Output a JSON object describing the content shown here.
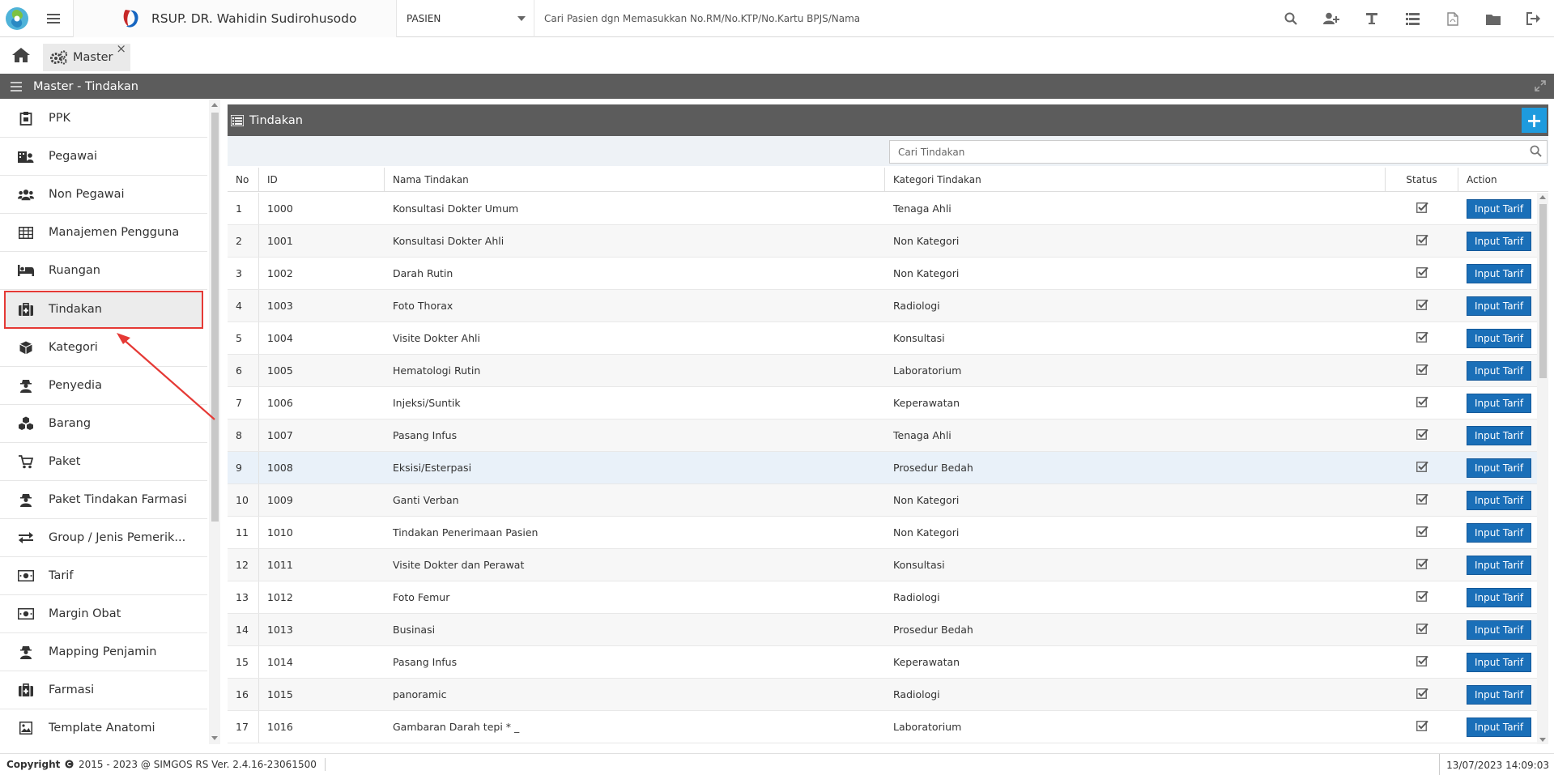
{
  "header": {
    "hospital_name": "RSUP. DR. Wahidin Sudirohusodo",
    "selector_value": "PASIEN",
    "search_placeholder": "Cari Pasien dgn Memasukkan No.RM/No.KTP/No.Kartu BPJS/Nama",
    "toolbar_icons": [
      "search-icon",
      "add-user-icon",
      "text-icon",
      "list-icon",
      "pdf-file-icon",
      "folder-icon",
      "logout-icon"
    ]
  },
  "tabs": [
    {
      "label": "Master",
      "icon": "gears-icon"
    }
  ],
  "title_bar": {
    "title": "Master - Tindakan"
  },
  "sidebar": {
    "items": [
      {
        "label": "PPK",
        "icon": "clipboard-icon"
      },
      {
        "label": "Pegawai",
        "icon": "building-user-icon"
      },
      {
        "label": "Non Pegawai",
        "icon": "users-icon"
      },
      {
        "label": "Manajemen Pengguna",
        "icon": "table-icon"
      },
      {
        "label": "Ruangan",
        "icon": "bed-icon"
      },
      {
        "label": "Tindakan",
        "icon": "medkit-icon",
        "active": true
      },
      {
        "label": "Kategori",
        "icon": "cube-icon"
      },
      {
        "label": "Penyedia",
        "icon": "user-secret-icon"
      },
      {
        "label": "Barang",
        "icon": "cubes-icon"
      },
      {
        "label": "Paket",
        "icon": "cart-icon"
      },
      {
        "label": "Paket Tindakan Farmasi",
        "icon": "user-secret-icon"
      },
      {
        "label": "Group / Jenis Pemerik...",
        "icon": "exchange-icon"
      },
      {
        "label": "Tarif",
        "icon": "money-icon"
      },
      {
        "label": "Margin Obat",
        "icon": "money-icon"
      },
      {
        "label": "Mapping Penjamin",
        "icon": "user-secret-icon"
      },
      {
        "label": "Farmasi",
        "icon": "medkit-icon"
      },
      {
        "label": "Template Anatomi",
        "icon": "image-icon"
      }
    ]
  },
  "panel": {
    "title": "Tindakan",
    "search_placeholder": "Cari Tindakan",
    "columns": {
      "no": "No",
      "id": "ID",
      "nama": "Nama Tindakan",
      "kategori": "Kategori Tindakan",
      "status": "Status",
      "action": "Action"
    },
    "action_label": "Input Tarif",
    "rows": [
      {
        "no": "1",
        "id": "1000",
        "nama": "Konsultasi Dokter Umum",
        "kategori": "Tenaga Ahli"
      },
      {
        "no": "2",
        "id": "1001",
        "nama": "Konsultasi Dokter Ahli",
        "kategori": "Non Kategori"
      },
      {
        "no": "3",
        "id": "1002",
        "nama": "Darah Rutin",
        "kategori": "Non Kategori"
      },
      {
        "no": "4",
        "id": "1003",
        "nama": "Foto Thorax",
        "kategori": "Radiologi"
      },
      {
        "no": "5",
        "id": "1004",
        "nama": "Visite Dokter Ahli",
        "kategori": "Konsultasi"
      },
      {
        "no": "6",
        "id": "1005",
        "nama": "Hematologi Rutin",
        "kategori": "Laboratorium"
      },
      {
        "no": "7",
        "id": "1006",
        "nama": "Injeksi/Suntik",
        "kategori": "Keperawatan"
      },
      {
        "no": "8",
        "id": "1007",
        "nama": "Pasang Infus",
        "kategori": "Tenaga Ahli"
      },
      {
        "no": "9",
        "id": "1008",
        "nama": "Eksisi/Esterpasi",
        "kategori": "Prosedur Bedah",
        "highlight": true
      },
      {
        "no": "10",
        "id": "1009",
        "nama": "Ganti Verban",
        "kategori": "Non Kategori"
      },
      {
        "no": "11",
        "id": "1010",
        "nama": "Tindakan Penerimaan Pasien",
        "kategori": "Non Kategori"
      },
      {
        "no": "12",
        "id": "1011",
        "nama": "Visite Dokter dan Perawat",
        "kategori": "Konsultasi"
      },
      {
        "no": "13",
        "id": "1012",
        "nama": "Foto Femur",
        "kategori": "Radiologi"
      },
      {
        "no": "14",
        "id": "1013",
        "nama": "Businasi",
        "kategori": "Prosedur Bedah"
      },
      {
        "no": "15",
        "id": "1014",
        "nama": "Pasang Infus",
        "kategori": "Keperawatan"
      },
      {
        "no": "16",
        "id": "1015",
        "nama": "panoramic",
        "kategori": "Radiologi"
      },
      {
        "no": "17",
        "id": "1016",
        "nama": "Gambaran Darah tepi * _",
        "kategori": "Laboratorium"
      }
    ]
  },
  "footer": {
    "copyright_label": "Copyright",
    "copyright_text": "2015 - 2023 @ SIMGOS RS Ver. 2.4.16-23061500",
    "datetime": "13/07/2023 14:09:03"
  },
  "colors": {
    "accent": "#1e9bde",
    "button": "#1a6fb8",
    "header_bar": "#5c5c5c",
    "annotation": "#e53935"
  }
}
